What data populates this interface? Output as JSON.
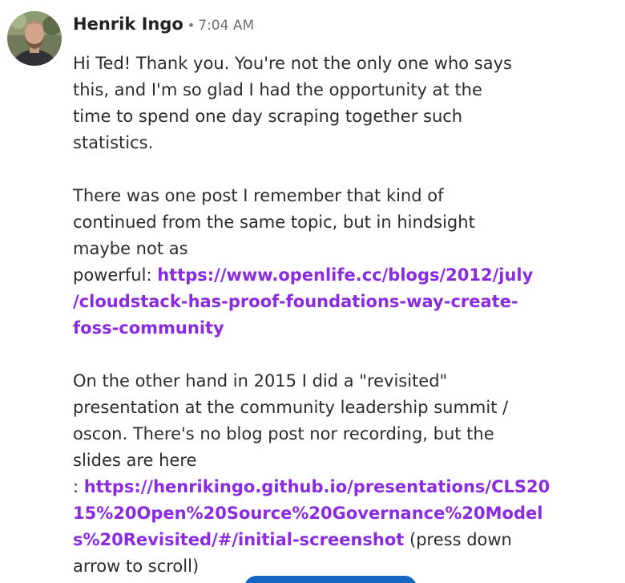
{
  "comment": {
    "author": "Henrik Ingo",
    "separator": "•",
    "time": "7:04 AM",
    "avatar_icon": "person-avatar",
    "paragraph1_lines": [
      "Hi Ted! Thank you. You're not the only one who says",
      "this, and I'm so glad I had the opportunity at the",
      "time to spend one day scraping together such",
      "statistics."
    ],
    "paragraph2_lines": [
      "There was one post I remember that kind of",
      "continued from the same topic, but in hindsight",
      "maybe not as"
    ],
    "paragraph2_prefix": "powerful: ",
    "link1_lines": [
      "https://www.openlife.cc/blogs/2012/july",
      "/cloudstack-has-proof-foundations-way-create-",
      "foss-community"
    ],
    "paragraph3_lines": [
      "On the other hand in 2015 I did a \"revisited\"",
      "presentation at the community leadership summit /",
      "oscon. There's no blog post nor recording, but the",
      "slides are here"
    ],
    "paragraph3_prefix": ": ",
    "link2_lines": [
      "https://henrikingo.github.io/presentations/CLS20",
      "15%20Open%20Source%20Governance%20Model",
      "s%20Revisited/#/initial-screenshot"
    ],
    "link2_suffix": " (press down",
    "trailing_line": "arrow to scroll)",
    "link_color": "#8a2be2",
    "button_color": "#1566c0"
  }
}
